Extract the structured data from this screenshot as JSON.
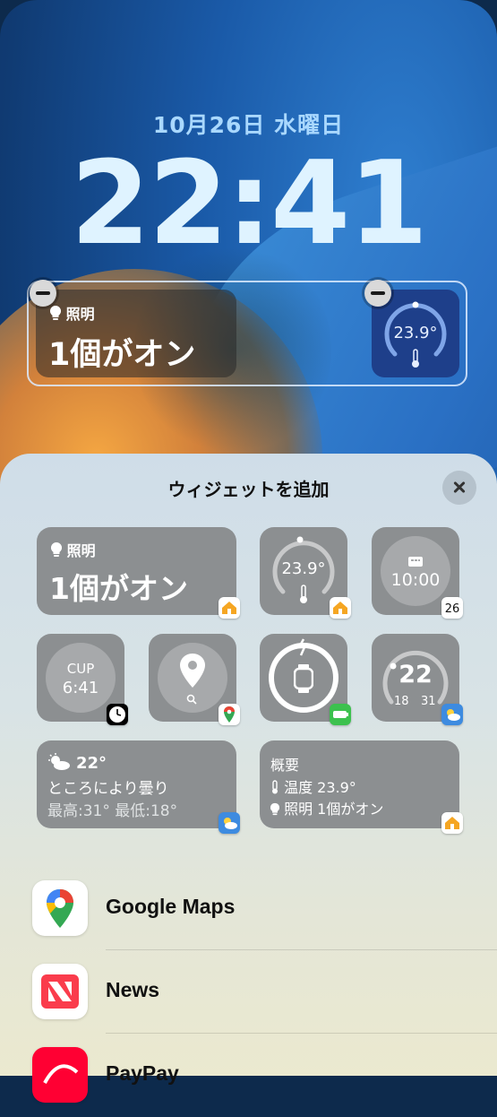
{
  "lockscreen": {
    "date": "10月26日 水曜日",
    "time": "22:41",
    "widget_lights": {
      "label": "照明",
      "value": "1個がオン"
    },
    "widget_temp": {
      "value": "23.9°"
    }
  },
  "sheet": {
    "title": "ウィジェットを追加",
    "widgets": {
      "lights": {
        "label": "照明",
        "value": "1個がオン"
      },
      "temp": {
        "value": "23.9°"
      },
      "alarm": {
        "value": "10:00",
        "badge": "26"
      },
      "clock": {
        "city": "CUP",
        "time": "6:41"
      },
      "weather_gauge": {
        "value": "22",
        "low": "18",
        "high": "31"
      },
      "weather_rect": {
        "temp": "22°",
        "condition": "ところにより曇り",
        "range": "最高:31° 最低:18°"
      },
      "summary": {
        "title": "概要",
        "line1": "温度  23.9°",
        "line2": "照明  1個がオン"
      }
    },
    "apps": [
      {
        "name": "Google Maps"
      },
      {
        "name": "News"
      },
      {
        "name": "PayPay"
      }
    ]
  }
}
